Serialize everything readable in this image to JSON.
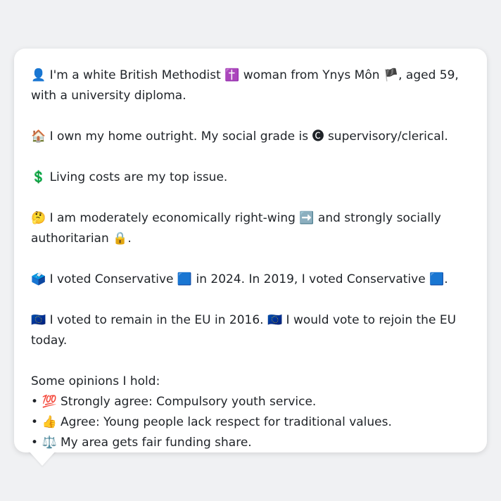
{
  "profile": {
    "line1_icon": "👤",
    "line1_a": "I'm a white British Methodist",
    "line1_cross": "✝️",
    "line1_b": "woman from Ynys Môn",
    "line1_flag": "🏴",
    "line1_c": ", aged 59, with a university diploma.",
    "line2_icon": "🏠",
    "line2_a": "I own my home outright. My social grade is",
    "line2_badge": "🅒",
    "line2_b": "supervisory/clerical.",
    "line3_icon": "💲",
    "line3": "Living costs are my top issue.",
    "line4_icon": "🤔",
    "line4_a": "I am moderately economically right-wing",
    "line4_arrow": "➡️",
    "line4_b": "and strongly socially authoritarian",
    "line4_lock": "🔒",
    "line4_c": ".",
    "line5_icon": "🗳️",
    "line5_a": "I voted Conservative",
    "line5_party1": "🟦",
    "line5_b": "in 2024. In 2019, I voted Conservative",
    "line5_party2": "🟦",
    "line5_c": ".",
    "line6_icon": "🇪🇺",
    "line6_a": "I voted to remain in the EU in 2016.",
    "line6_icon2": "🇪🇺",
    "line6_b": "I would vote to rejoin the EU today."
  },
  "opinions": {
    "heading": "Some opinions I hold:",
    "items": [
      {
        "bullet": "•",
        "icon": "💯",
        "text": "Strongly agree: Compulsory youth service."
      },
      {
        "bullet": "•",
        "icon": "👍",
        "text": "Agree: Young people lack respect for traditional values."
      },
      {
        "bullet": "•",
        "icon": "⚖️",
        "text": "My area gets fair funding share."
      }
    ]
  },
  "colors": {
    "background": "#f0f1f3",
    "card": "#ffffff",
    "text": "#1f2328"
  }
}
